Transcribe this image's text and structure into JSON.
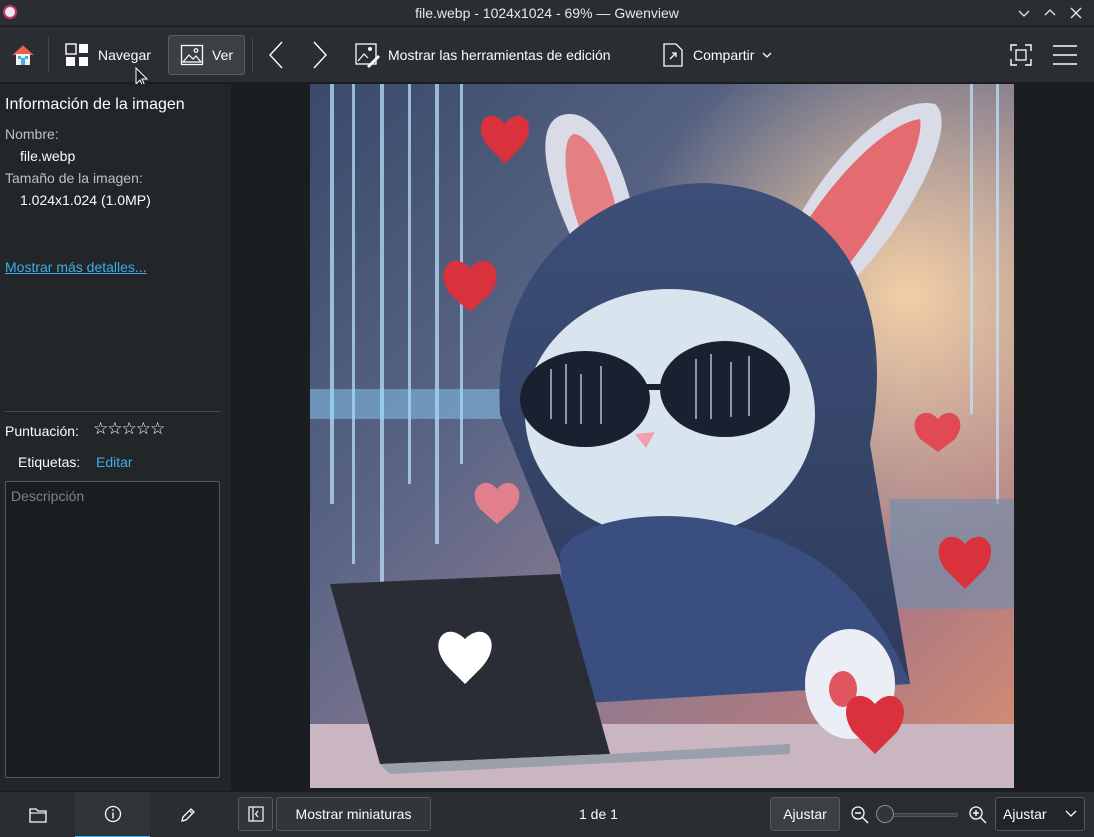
{
  "window": {
    "title": "file.webp - 1024x1024 - 69% — Gwenview"
  },
  "toolbar": {
    "browse_label": "Navegar",
    "view_label": "Ver",
    "edit_tools_label": "Mostrar las herramientas de edición",
    "share_label": "Compartir"
  },
  "sidebar": {
    "heading": "Información de la imagen",
    "name_label": "Nombre:",
    "name_value": "file.webp",
    "size_label": "Tamaño de la imagen:",
    "size_value": "1.024x1.024 (1.0MP)",
    "more_details": "Mostrar más detalles...",
    "rating_label": "Puntuación:",
    "rating_stars": "☆☆☆☆☆",
    "rating_value": 0,
    "tags_label": "Etiquetas:",
    "tags_edit": "Editar",
    "description_placeholder": "Descripción"
  },
  "bottombar": {
    "thumbnails_label": "Mostrar miniaturas",
    "page_count": "1 de 1",
    "fit_button": "Ajustar",
    "zoom_select_value": "Ajustar"
  },
  "colors": {
    "accent": "#3daee9",
    "background": "#1b1e20",
    "panel": "#2a2e32"
  },
  "icons": {
    "home": "home-icon",
    "browse": "grid-icon",
    "view": "image-icon",
    "prev": "chevron-left-icon",
    "next": "chevron-right-icon",
    "edit_tools": "image-edit-icon",
    "share": "share-icon",
    "fullscreen": "fullscreen-icon",
    "menu": "hamburger-menu-icon"
  }
}
